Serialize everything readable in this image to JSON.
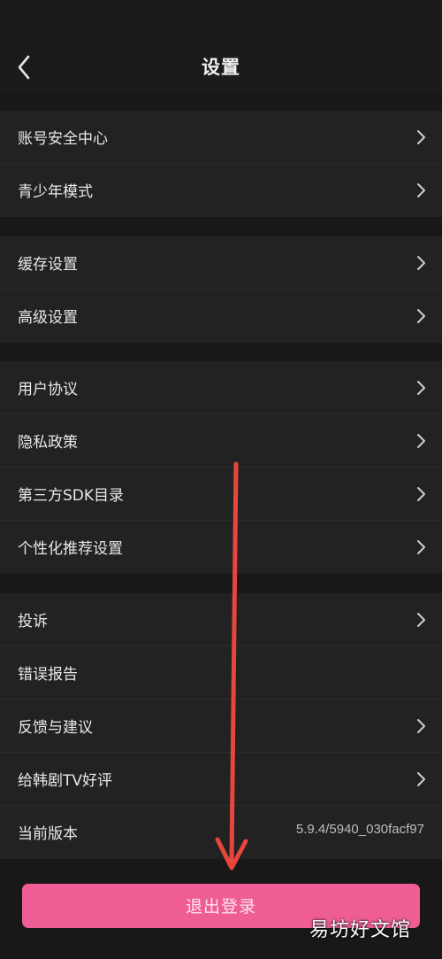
{
  "header": {
    "title": "设置",
    "back_icon": "chevron-left-icon"
  },
  "groups": [
    {
      "items": [
        {
          "label": "账号安全中心",
          "has_chevron": true
        },
        {
          "label": "青少年模式",
          "has_chevron": true
        }
      ]
    },
    {
      "items": [
        {
          "label": "缓存设置",
          "has_chevron": true
        },
        {
          "label": "高级设置",
          "has_chevron": true
        }
      ]
    },
    {
      "items": [
        {
          "label": "用户协议",
          "has_chevron": true
        },
        {
          "label": "隐私政策",
          "has_chevron": true
        },
        {
          "label": "第三方SDK目录",
          "has_chevron": true
        },
        {
          "label": "个性化推荐设置",
          "has_chevron": true
        }
      ]
    },
    {
      "items": [
        {
          "label": "投诉",
          "has_chevron": true
        },
        {
          "label": "错误报告",
          "has_chevron": false
        },
        {
          "label": "反馈与建议",
          "has_chevron": true
        },
        {
          "label": "给韩剧TV好评",
          "has_chevron": true
        },
        {
          "label": "当前版本",
          "value": "5.9.4/5940_030facf97",
          "has_chevron": false
        }
      ]
    }
  ],
  "logout": {
    "label": "退出登录",
    "color": "#ef5d95"
  },
  "annotation": {
    "arrow_color": "#e8453c",
    "arrow_icon": "arrow-down-icon"
  },
  "watermark": {
    "text": "易坊好文馆"
  },
  "colors": {
    "background": "#181818",
    "row_background": "#222222"
  }
}
